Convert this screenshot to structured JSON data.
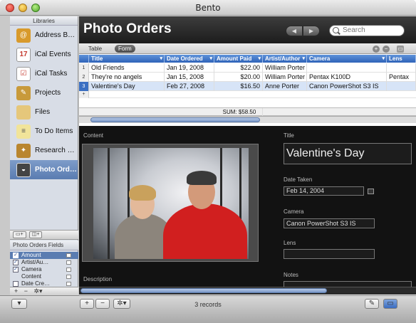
{
  "window": {
    "title": "Bento"
  },
  "sidebar": {
    "header": "Libraries",
    "items": [
      {
        "label": "Address B…",
        "icon": "address-book-icon",
        "color": "#d89a2c"
      },
      {
        "label": "iCal Events",
        "icon": "calendar-icon",
        "color": "#c43a2f"
      },
      {
        "label": "iCal Tasks",
        "icon": "tasks-icon",
        "color": "#b8b8b8"
      },
      {
        "label": "Projects",
        "icon": "projects-icon",
        "color": "#c89a3b"
      },
      {
        "label": "Files",
        "icon": "files-icon",
        "color": "#e5c77b"
      },
      {
        "label": "To Do Items",
        "icon": "todo-icon",
        "color": "#e0cf6d"
      },
      {
        "label": "Research …",
        "icon": "research-icon",
        "color": "#b9862f"
      },
      {
        "label": "Photo Ord…",
        "icon": "photo-orders-icon",
        "color": "#444444",
        "selected": true
      }
    ],
    "fields_header": "Photo Orders Fields",
    "fields": [
      {
        "label": "Amount",
        "checked": true,
        "selected": true
      },
      {
        "label": "Artist/Au…",
        "checked": true
      },
      {
        "label": "Camera",
        "checked": true
      },
      {
        "label": "Content",
        "checked": false
      },
      {
        "label": "Date Cre…",
        "checked": false
      }
    ],
    "bottom_controls": "+ − ✲▾"
  },
  "header": {
    "title": "Photo Orders",
    "search_placeholder": "Search"
  },
  "view_tabs": {
    "table": "Table",
    "form": "Form"
  },
  "grid": {
    "columns": [
      "Title",
      "Date Ordered",
      "Amount Paid",
      "Artist/Author",
      "Camera",
      "Lens"
    ],
    "rows": [
      {
        "n": "1",
        "cells": [
          "Old Friends",
          "Jan 19, 2008",
          "$22.00",
          "William Porter",
          "",
          ""
        ]
      },
      {
        "n": "2",
        "cells": [
          "They're no angels",
          "Jan 15, 2008",
          "$20.00",
          "William Porter",
          "Pentax K100D",
          "Pentax"
        ]
      },
      {
        "n": "3",
        "cells": [
          "Valentine's Day",
          "Feb 27, 2008",
          "$16.50",
          "Anne Porter",
          "Canon PowerShot S3 IS",
          ""
        ],
        "selected": true
      }
    ],
    "sum": "SUM: $58.50"
  },
  "form": {
    "content_label": "Content",
    "description_label": "Description",
    "title_label": "Title",
    "title_value": "Valentine's Day",
    "date_label": "Date Taken",
    "date_value": "Feb 14, 2004",
    "camera_label": "Camera",
    "camera_value": "Canon PowerShot S3 IS",
    "lens_label": "Lens",
    "notes_label": "Notes"
  },
  "statusbar": {
    "records": "3 records"
  }
}
